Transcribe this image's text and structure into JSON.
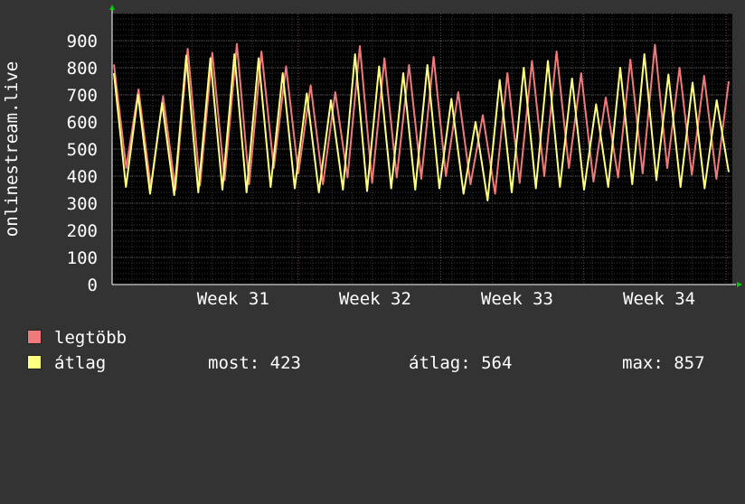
{
  "chart_data": {
    "type": "line",
    "ylabel": "onlinestream.live",
    "ylim": [
      0,
      1000
    ],
    "y_ticks": [
      "0",
      "100",
      "200",
      "300",
      "400",
      "500",
      "600",
      "700",
      "800",
      "900"
    ],
    "x_tick_labels": [
      "Week 31",
      "Week 32",
      "Week 33",
      "Week 34"
    ],
    "grid": true,
    "background": "#000000",
    "series": [
      {
        "name": "legtöbb",
        "color": "#f07a7a",
        "values": [
          812,
          430,
          720,
          360,
          695,
          350,
          870,
          365,
          855,
          385,
          888,
          370,
          860,
          430,
          805,
          410,
          735,
          370,
          710,
          395,
          880,
          375,
          835,
          395,
          810,
          390,
          840,
          400,
          710,
          370,
          625,
          335,
          780,
          375,
          825,
          400,
          860,
          430,
          780,
          380,
          690,
          395,
          830,
          410,
          885,
          430,
          800,
          405,
          770,
          390,
          750
        ]
      },
      {
        "name": "átlag",
        "color": "#ffff80",
        "values": [
          780,
          360,
          700,
          335,
          670,
          330,
          845,
          340,
          835,
          350,
          850,
          340,
          835,
          360,
          780,
          355,
          705,
          340,
          680,
          350,
          850,
          345,
          805,
          355,
          780,
          350,
          810,
          355,
          685,
          335,
          600,
          310,
          755,
          340,
          800,
          355,
          825,
          360,
          760,
          350,
          665,
          360,
          800,
          370,
          850,
          385,
          775,
          360,
          745,
          355,
          680,
          415
        ]
      }
    ]
  },
  "legend": {
    "max_label": "legtöbb",
    "avg_label": "átlag",
    "stats": {
      "current": "most: 423",
      "average": "átlag: 564",
      "maximum": "max: 857"
    }
  }
}
